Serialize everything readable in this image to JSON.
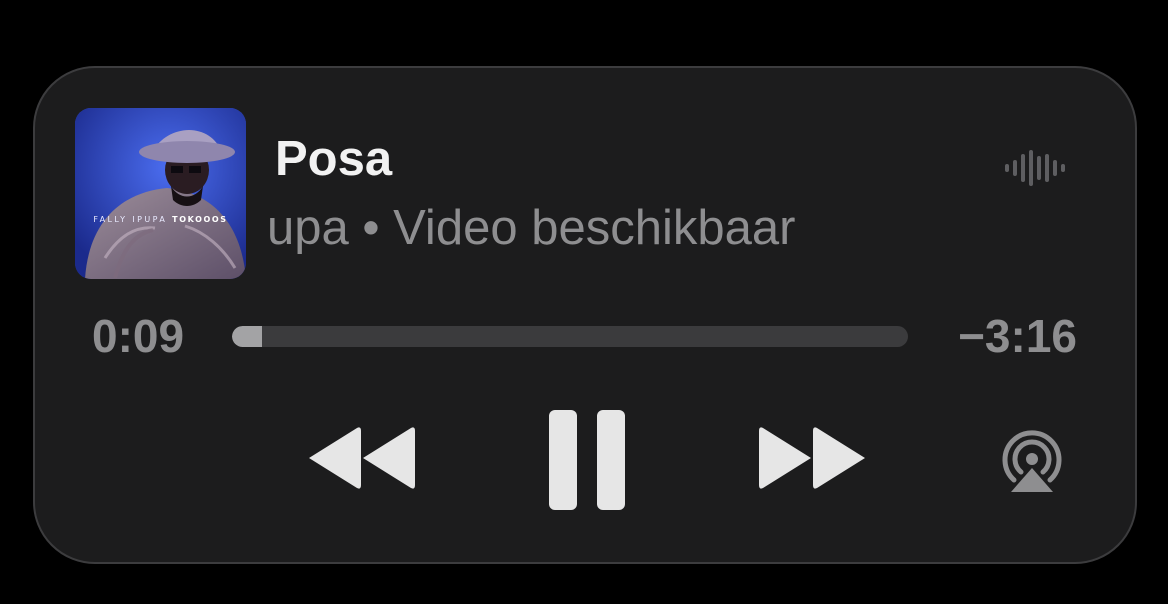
{
  "track": {
    "title": "Posa",
    "subtitle": "upa • Video beschikbaar",
    "artwork": {
      "artist_text": "FALLY IPUPA",
      "album_text": "TOKOOOS"
    }
  },
  "playback": {
    "elapsed": "0:09",
    "remaining": "−3:16",
    "progress_fraction": 0.045,
    "state": "playing"
  },
  "icons": {
    "waveform": "waveform-icon",
    "rewind": "rewind-icon",
    "pause": "pause-icon",
    "fast_forward": "fast-forward-icon",
    "airplay": "airplay-icon"
  },
  "colors": {
    "background": "#000000",
    "panel": "#1c1c1d",
    "title": "#f2f2f2",
    "secondary_text": "#8e8e90",
    "track": "#3b3b3d",
    "progress": "#a3a3a5",
    "controls": "#e6e6e6"
  }
}
